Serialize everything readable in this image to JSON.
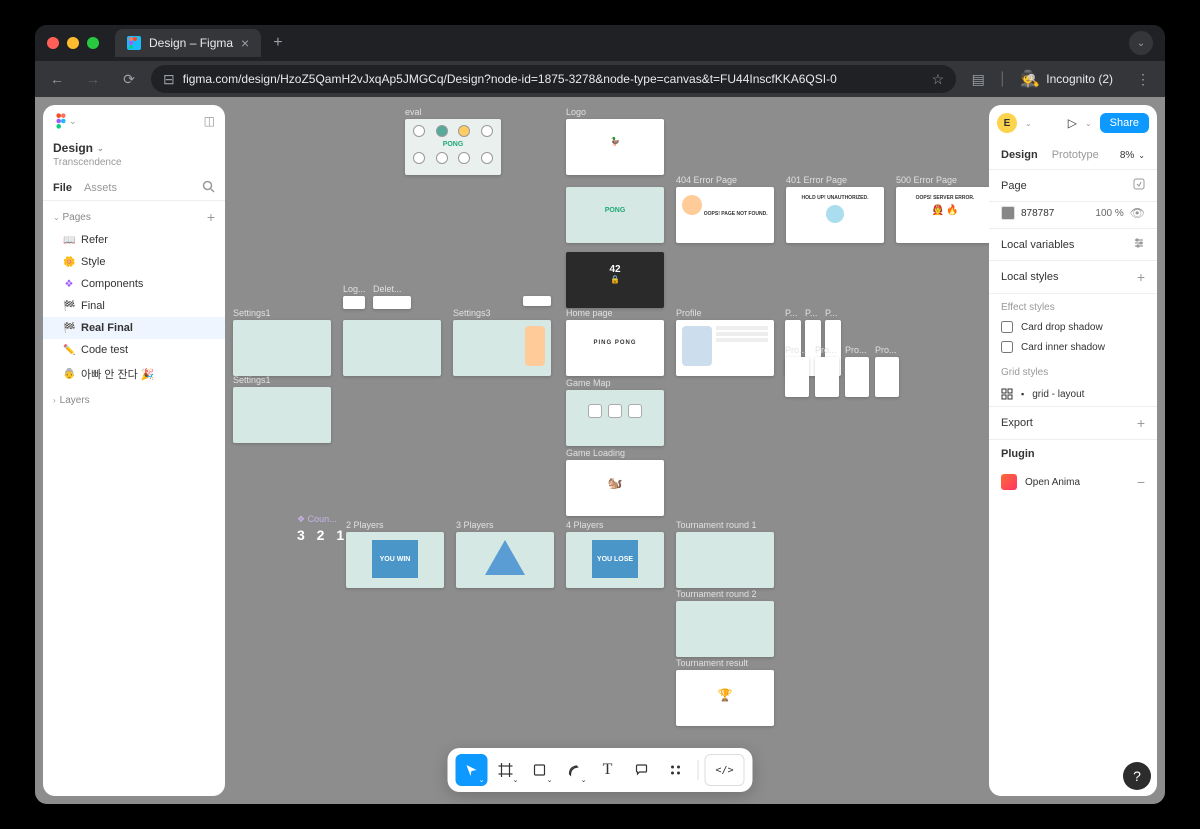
{
  "browser": {
    "tab_title": "Design – Figma",
    "url": "figma.com/design/HzoZ5QamH2vJxqAp5JMGCq/Design?node-id=1875-3278&node-type=canvas&t=FU44InscfKKA6QSI-0",
    "incognito_label": "Incognito (2)"
  },
  "left_panel": {
    "file_title": "Design",
    "file_subtitle": "Transcendence",
    "tabs": {
      "file": "File",
      "assets": "Assets"
    },
    "pages_header": "Pages",
    "pages": [
      {
        "emoji": "📖",
        "label": "Refer"
      },
      {
        "emoji": "🌼",
        "label": "Style"
      },
      {
        "emoji": "❖",
        "label": "Components"
      },
      {
        "emoji": "🏁",
        "label": "Final"
      },
      {
        "emoji": "🏁",
        "label": "Real Final"
      },
      {
        "emoji": "✏️",
        "label": "Code test"
      },
      {
        "emoji": "👵",
        "label": "아빠 안 잔다 🎉"
      }
    ],
    "layers_header": "Layers"
  },
  "right_panel": {
    "avatar_letter": "E",
    "share": "Share",
    "tabs": {
      "design": "Design",
      "prototype": "Prototype"
    },
    "zoom": "8%",
    "page_header": "Page",
    "page_color": "878787",
    "page_opacity": "100",
    "page_opacity_unit": "%",
    "local_variables": "Local variables",
    "local_styles": "Local styles",
    "effect_styles": "Effect styles",
    "effects": [
      "Card drop shadow",
      "Card inner shadow"
    ],
    "grid_styles": "Grid styles",
    "grid_item": "grid - layout",
    "export": "Export",
    "plugin": "Plugin",
    "plugin_item": "Open Anima"
  },
  "frames": {
    "eval": "eval",
    "logo": "Logo",
    "err404": "404 Error Page",
    "err404_text": "OOPS! PAGE NOT FOUND.",
    "err401": "401 Error Page",
    "err401_text": "HOLD UP! UNAUTHORIZED.",
    "err500": "500 Error Page",
    "err500_text": "OOPS! SERVER ERROR.",
    "login": "Log...",
    "delete": "Delet...",
    "settings1": "Settings1",
    "settings3": "Settings3",
    "homepage": "Home page",
    "profile": "Profile",
    "pro": "Pro...",
    "p": "P...",
    "gamemap": "Game Map",
    "gameloading": "Game Loading",
    "countdown": "❖ Coun...",
    "countdown_text": "3 2 1",
    "players2": "2 Players",
    "players3": "3 Players",
    "players4": "4 Players",
    "youwin": "YOU WIN",
    "youlose": "YOU LOSE",
    "tr1": "Tournament round 1",
    "tr2": "Tournament round 2",
    "tres": "Tournament result",
    "pingpong": "PING PONG",
    "pong": "PONG"
  }
}
